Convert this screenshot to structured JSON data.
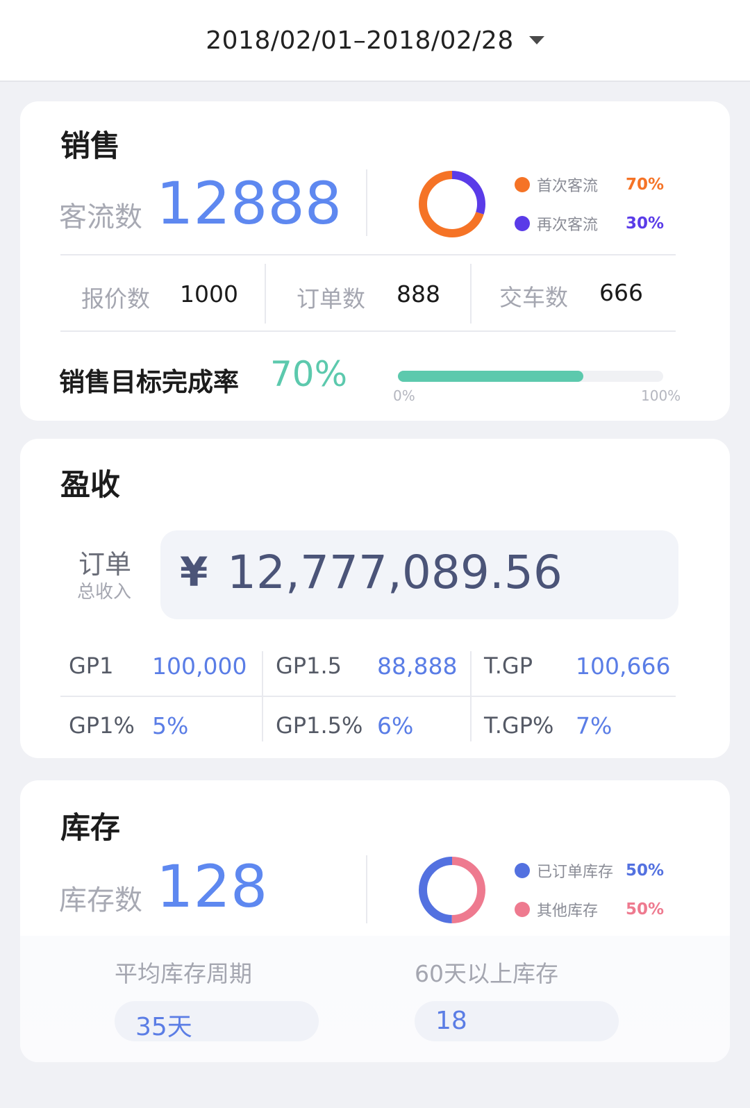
{
  "header": {
    "date_range": "2018/02/01–2018/02/28"
  },
  "sales": {
    "title": "销售",
    "visitors_label": "客流数",
    "visitors_value": "12888",
    "legend": [
      {
        "label": "首次客流",
        "pct": "70%",
        "color": "#f57326",
        "value": 70
      },
      {
        "label": "再次客流",
        "pct": "30%",
        "color": "#5a3be8",
        "value": 30
      }
    ],
    "stats": [
      {
        "label": "报价数",
        "value": "1000"
      },
      {
        "label": "订单数",
        "value": "888"
      },
      {
        "label": "交车数",
        "value": "666"
      }
    ],
    "target_label": "销售目标完成率",
    "target_pct": "70%",
    "target_value": 0.7,
    "progress_min": "0%",
    "progress_max": "100%"
  },
  "revenue": {
    "title": "盈收",
    "order_label": "订单",
    "order_sublabel": "总收入",
    "currency": "¥",
    "amount": "12,777,089.56",
    "row1": [
      {
        "label": "GP1",
        "value": "100,000"
      },
      {
        "label": "GP1.5",
        "value": "88,888"
      },
      {
        "label": "T.GP",
        "value": "100,666"
      }
    ],
    "row2": [
      {
        "label": "GP1%",
        "value": "5%"
      },
      {
        "label": "GP1.5%",
        "value": "6%"
      },
      {
        "label": "T.GP%",
        "value": "7%"
      }
    ]
  },
  "inventory": {
    "title": "库存",
    "count_label": "库存数",
    "count_value": "128",
    "legend": [
      {
        "label": "已订单库存",
        "pct": "50%",
        "color": "#5371e0",
        "value": 50
      },
      {
        "label": "其他库存",
        "pct": "50%",
        "color": "#ee7a8f",
        "value": 50
      }
    ],
    "avg_cycle_label": "平均库存周期",
    "avg_cycle_value": "35天",
    "over60_label": "60天以上库存",
    "over60_value": "18"
  },
  "colors": {
    "accent_blue": "#5e88f0",
    "progress_green": "#5cc9ad",
    "orange": "#f57326",
    "purple": "#5a3be8"
  }
}
